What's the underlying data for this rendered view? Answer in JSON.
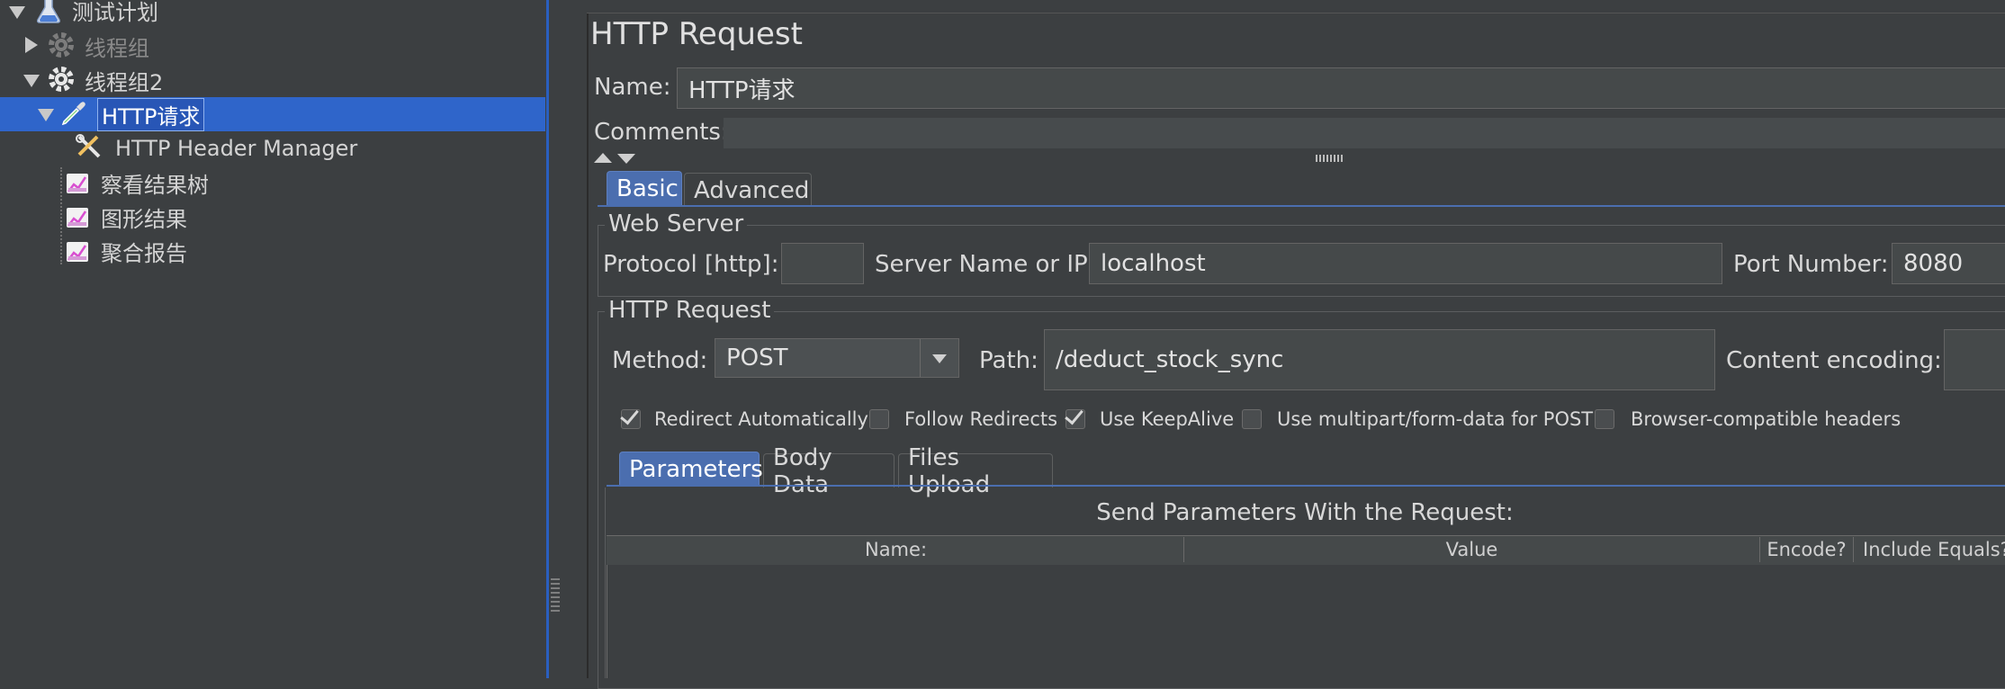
{
  "tree": {
    "items": [
      {
        "label": "测试计划"
      },
      {
        "label": "线程组"
      },
      {
        "label": "线程组2"
      },
      {
        "label": "HTTP请求"
      },
      {
        "label": "HTTP Header Manager"
      },
      {
        "label": "察看结果树"
      },
      {
        "label": "图形结果"
      },
      {
        "label": "聚合报告"
      }
    ]
  },
  "panel": {
    "title": "HTTP Request",
    "name_label": "Name:",
    "name_value": "HTTP请求",
    "comments_label": "Comments:",
    "comments_value": "",
    "tabs": [
      {
        "label": "Basic"
      },
      {
        "label": "Advanced"
      }
    ],
    "web_server": {
      "legend": "Web Server",
      "protocol_label": "Protocol [http]:",
      "protocol_value": "",
      "server_label": "Server Name or IP:",
      "server_value": "localhost",
      "port_label": "Port Number:",
      "port_value": "8080"
    },
    "http_request": {
      "legend": "HTTP Request",
      "method_label": "Method:",
      "method_value": "POST",
      "path_label": "Path:",
      "path_value": "/deduct_stock_sync",
      "encoding_label": "Content encoding:",
      "encoding_value": ""
    },
    "checkboxes": [
      {
        "label": "Redirect Automatically",
        "checked": true
      },
      {
        "label": "Follow Redirects",
        "checked": false
      },
      {
        "label": "Use KeepAlive",
        "checked": true
      },
      {
        "label": "Use multipart/form-data for POST",
        "checked": false
      },
      {
        "label": "Browser-compatible headers",
        "checked": false
      }
    ],
    "sub_tabs": [
      {
        "label": "Parameters"
      },
      {
        "label": "Body Data"
      },
      {
        "label": "Files Upload"
      }
    ],
    "params_title": "Send Parameters With the Request:",
    "columns": [
      "Name:",
      "Value",
      "Encode?",
      "Include Equals?"
    ]
  },
  "colors": {
    "selection": "#2f65ca",
    "tab_active": "#4b6eaf",
    "background": "#3c3f41"
  }
}
